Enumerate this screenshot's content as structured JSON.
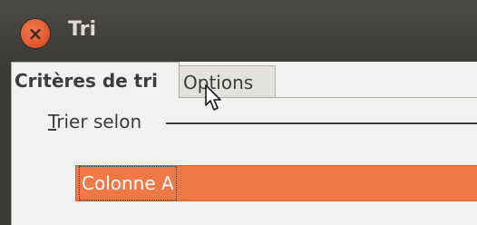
{
  "window": {
    "title": "Tri"
  },
  "tabs": [
    {
      "label": "Critères de tri",
      "active": true
    },
    {
      "label": "Options",
      "active": false
    }
  ],
  "sort": {
    "group_label_mnemonic": "T",
    "group_label_rest": "rier selon",
    "selected": "Colonne A"
  },
  "colors": {
    "accent": "#f07746",
    "titlebar": "#3c3b37",
    "close": "#e1542a"
  }
}
